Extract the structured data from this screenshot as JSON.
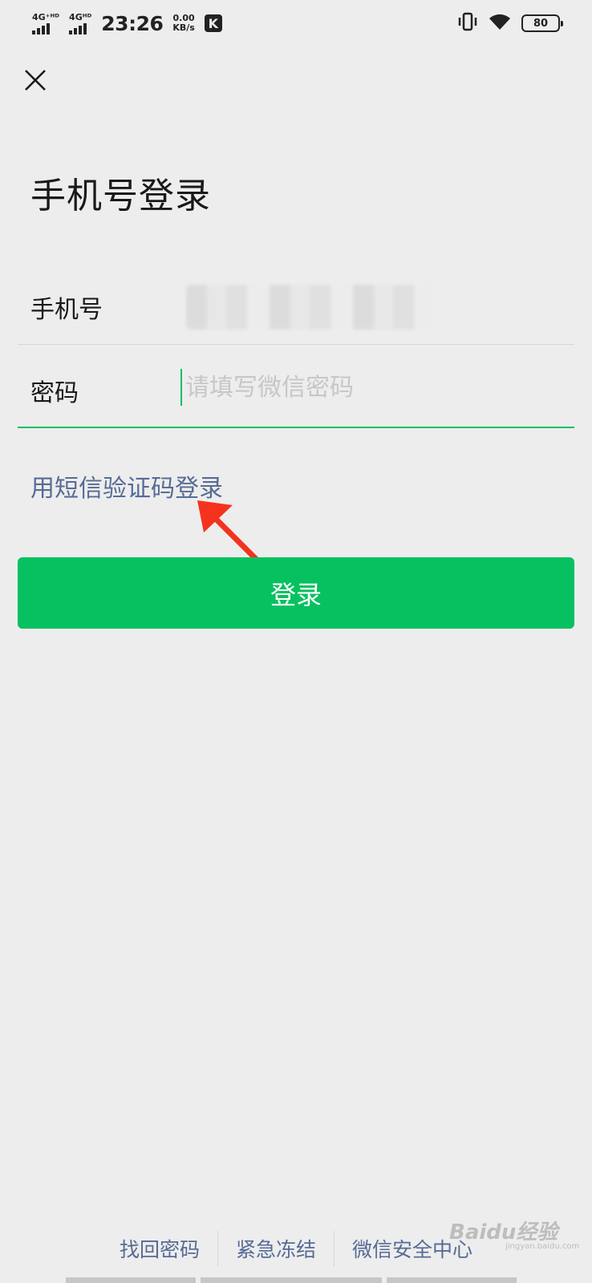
{
  "status_bar": {
    "network1": "4G⁺ᴴᴰ",
    "network2": "4Gᴴᴰ",
    "time": "23:26",
    "speed_value": "0.00",
    "speed_unit": "KB/s",
    "app_icon_letter": "K",
    "battery": "80",
    "icons": [
      "signal-icon",
      "signal-icon",
      "k-app-icon",
      "vibrate-icon",
      "wifi-icon",
      "battery-icon"
    ]
  },
  "header": {
    "close_icon": "close-icon"
  },
  "page": {
    "title": "手机号登录"
  },
  "form": {
    "phone_label": "手机号",
    "phone_value_obscured": "",
    "password_label": "密码",
    "password_placeholder": "请填写微信密码",
    "password_value": ""
  },
  "links": {
    "sms_login": "用短信验证码登录"
  },
  "buttons": {
    "login": "登录"
  },
  "footer": {
    "items": [
      "找回密码",
      "紧急冻结",
      "微信安全中心"
    ]
  },
  "annotation": {
    "arrow_color": "#f5321e"
  },
  "watermark": {
    "text": "Baidu经验",
    "sub": "jingyan.baidu.com"
  },
  "colors": {
    "background": "#ededed",
    "accent_green": "#07c160",
    "link_blue": "#576b95"
  }
}
